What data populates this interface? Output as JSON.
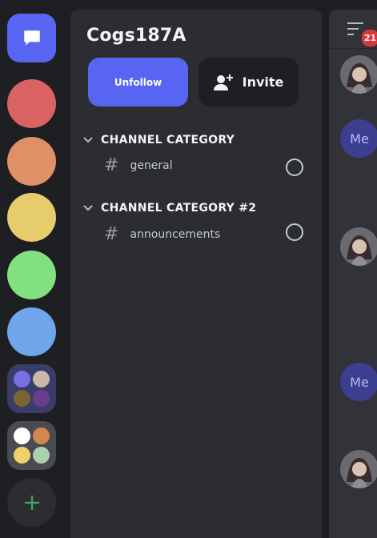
{
  "rail": {
    "servers": [
      {
        "name": "red-server",
        "color": "#da6262"
      },
      {
        "name": "orange-server",
        "color": "#e09066"
      },
      {
        "name": "yellow-server",
        "color": "#e6cc6b"
      },
      {
        "name": "green-server",
        "color": "#82e07f"
      },
      {
        "name": "blue-server",
        "color": "#6fa5e9"
      }
    ],
    "folders": [
      {
        "colors": [
          "#7a6ee6",
          "#c9b9a6",
          "#7a6430",
          "#6a3d8f"
        ],
        "bg": "#3a3d6a"
      },
      {
        "colors": [
          "#ffffff",
          "#d2884f",
          "#f1d06c",
          "#a9d0b0"
        ],
        "bg": "#4a4b52"
      }
    ],
    "accent": "#5865f2",
    "add_color": "#3ba55d"
  },
  "panel": {
    "server_name": "Cogs187A",
    "unfollow_label": "Unfollow",
    "invite_label": "Invite",
    "categories": [
      {
        "label": "CHANNEL CATEGORY",
        "channel": "general"
      },
      {
        "label": "CHANNEL CATEGORY #2",
        "channel": "announcements"
      }
    ]
  },
  "right": {
    "badge_count": "21",
    "me_label": "Me"
  }
}
